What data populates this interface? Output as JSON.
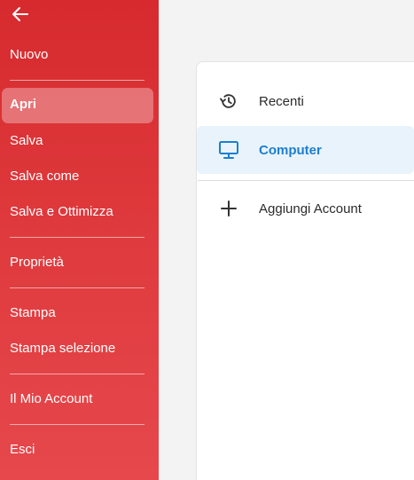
{
  "sidebar": {
    "back_icon": "arrow-left-icon",
    "items": [
      {
        "label": "Nuovo"
      },
      {
        "label": "Apri",
        "active": true
      },
      {
        "label": "Salva"
      },
      {
        "label": "Salva come"
      },
      {
        "label": "Salva e Ottimizza"
      },
      {
        "label": "Proprietà"
      },
      {
        "label": "Stampa"
      },
      {
        "label": "Stampa selezione"
      },
      {
        "label": "Il Mio Account"
      },
      {
        "label": "Esci"
      }
    ],
    "background_color": "#d62a2e"
  },
  "open_panel": {
    "items": [
      {
        "label": "Recenti",
        "icon": "history-icon"
      },
      {
        "label": "Computer",
        "icon": "monitor-icon",
        "selected": true
      },
      {
        "label": "Aggiungi Account",
        "icon": "plus-icon"
      }
    ],
    "accent_color": "#1a7fd0"
  }
}
